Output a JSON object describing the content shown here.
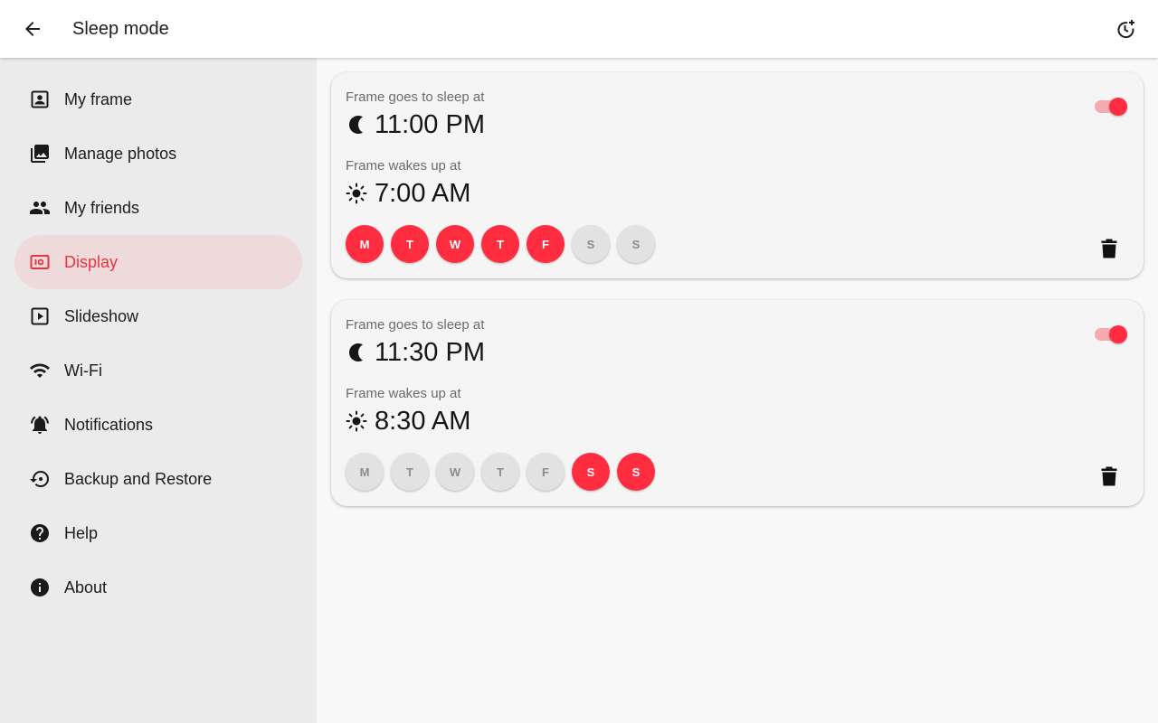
{
  "header": {
    "title": "Sleep mode",
    "back_icon": "arrow-back-icon",
    "add_icon": "add-alarm-icon"
  },
  "sidebar": {
    "items": [
      {
        "label": "My frame",
        "icon": "portrait-icon",
        "active": false
      },
      {
        "label": "Manage photos",
        "icon": "photo-library-icon",
        "active": false
      },
      {
        "label": "My friends",
        "icon": "people-icon",
        "active": false
      },
      {
        "label": "Display",
        "icon": "display-settings-icon",
        "active": true
      },
      {
        "label": "Slideshow",
        "icon": "slideshow-icon",
        "active": false
      },
      {
        "label": "Wi-Fi",
        "icon": "wifi-icon",
        "active": false
      },
      {
        "label": "Notifications",
        "icon": "notifications-icon",
        "active": false
      },
      {
        "label": "Backup and Restore",
        "icon": "restore-icon",
        "active": false
      },
      {
        "label": "Help",
        "icon": "help-icon",
        "active": false
      },
      {
        "label": "About",
        "icon": "info-icon",
        "active": false
      }
    ]
  },
  "schedules": [
    {
      "sleep_label": "Frame goes to sleep at",
      "sleep_time": "11:00 PM",
      "wake_label": "Frame wakes up at",
      "wake_time": "7:00 AM",
      "enabled": true,
      "days": [
        {
          "label": "M",
          "on": true
        },
        {
          "label": "T",
          "on": true
        },
        {
          "label": "W",
          "on": true
        },
        {
          "label": "T",
          "on": true
        },
        {
          "label": "F",
          "on": true
        },
        {
          "label": "S",
          "on": false
        },
        {
          "label": "S",
          "on": false
        }
      ]
    },
    {
      "sleep_label": "Frame goes to sleep at",
      "sleep_time": "11:30 PM",
      "wake_label": "Frame wakes up at",
      "wake_time": "8:30 AM",
      "enabled": true,
      "days": [
        {
          "label": "M",
          "on": false
        },
        {
          "label": "T",
          "on": false
        },
        {
          "label": "W",
          "on": false
        },
        {
          "label": "T",
          "on": false
        },
        {
          "label": "F",
          "on": false
        },
        {
          "label": "S",
          "on": true
        },
        {
          "label": "S",
          "on": true
        }
      ]
    }
  ],
  "colors": {
    "accent": "#ff2d3f",
    "active_nav_bg": "#eed9db",
    "sidebar_bg": "#ebebeb"
  }
}
